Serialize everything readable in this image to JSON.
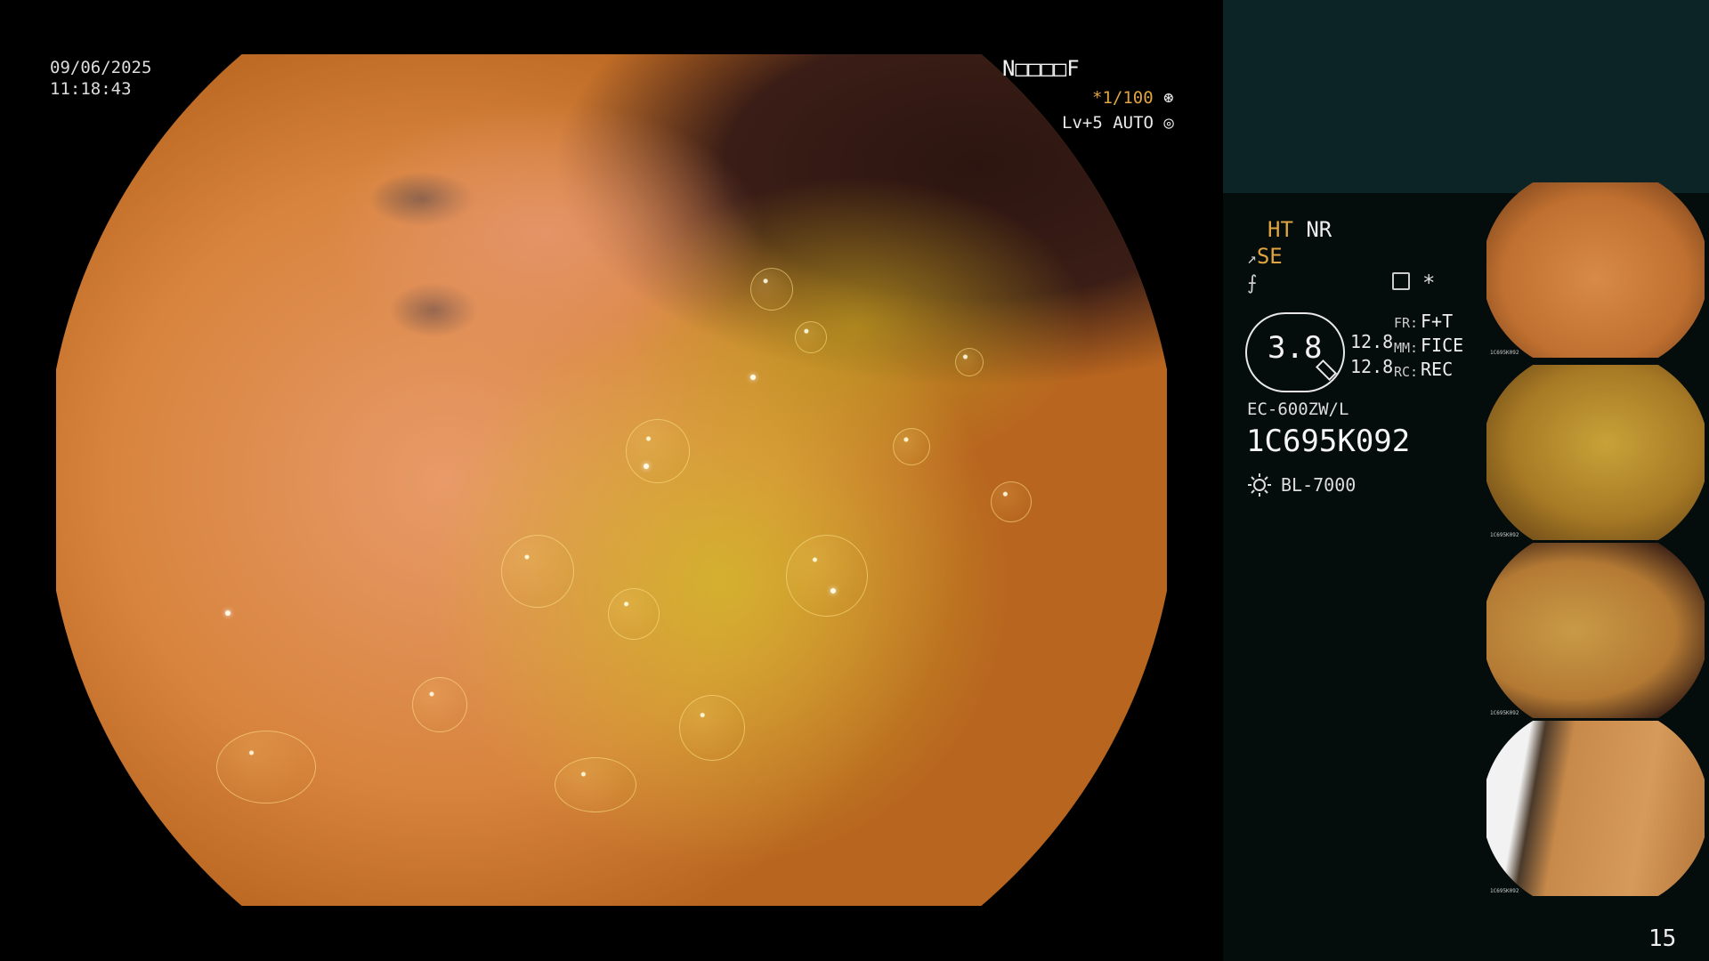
{
  "overlay": {
    "date": "09/06/2025",
    "time": "11:18:43",
    "top_right_code": "N□□□□F",
    "shutter": "*1/100",
    "level": "Lv+5 AUTO"
  },
  "panel": {
    "ht": "HT",
    "nr": "NR",
    "se": "SE",
    "gauge_value": "3.8",
    "value_1": "12.8",
    "value_2": "12.8",
    "fr_label": "FR:",
    "fr_value": "F+T",
    "mm_label": "MM:",
    "mm_value": "FICE",
    "rc_label": "RC:",
    "rc_value": "REC",
    "scope_model": "EC-600ZW/L",
    "serial": "1C695K092",
    "light_source": "BL-7000"
  },
  "thumbnails": [
    {
      "caption": "1C695K092"
    },
    {
      "caption": "1C695K092"
    },
    {
      "caption": "1C695K092"
    },
    {
      "caption": "1C695K092"
    }
  ],
  "page_number": "15",
  "icons": [
    "shutter-icon",
    "auto-iris-icon",
    "scope-bend-icon",
    "free-icon",
    "menu-icon",
    "star-icon",
    "sun-icon"
  ],
  "colors": {
    "accent": "#e0a440",
    "panel_top": "#0d2426",
    "panel_bottom": "#050c0c"
  }
}
